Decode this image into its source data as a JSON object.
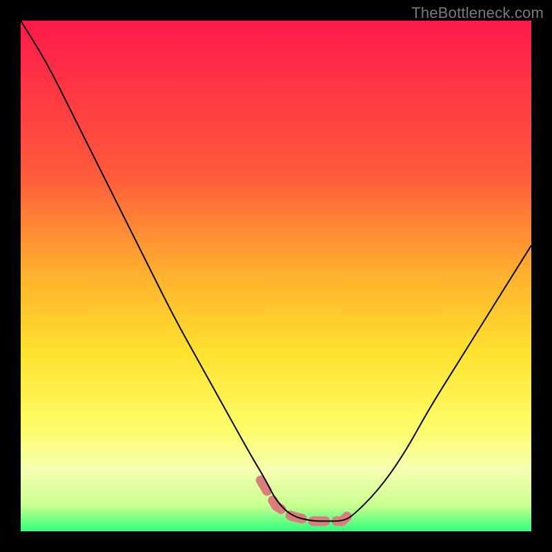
{
  "watermark": "TheBottleneck.com",
  "chart_data": {
    "type": "line",
    "title": "",
    "xlabel": "",
    "ylabel": "",
    "xlim": [
      0,
      100
    ],
    "ylim": [
      0,
      100
    ],
    "gradient": {
      "stops": [
        {
          "offset": 0,
          "color": "#ff1a4a"
        },
        {
          "offset": 30,
          "color": "#ff5a3c"
        },
        {
          "offset": 50,
          "color": "#ffb22e"
        },
        {
          "offset": 65,
          "color": "#ffe22e"
        },
        {
          "offset": 80,
          "color": "#fdfd6a"
        },
        {
          "offset": 88,
          "color": "#f6ffb0"
        },
        {
          "offset": 95,
          "color": "#c8ff90"
        },
        {
          "offset": 100,
          "color": "#2cff7a"
        }
      ]
    },
    "series": [
      {
        "name": "bottleneck-curve",
        "x": [
          0,
          5,
          10,
          15,
          20,
          25,
          30,
          35,
          40,
          45,
          48,
          50,
          53,
          57,
          60,
          63,
          65,
          70,
          75,
          80,
          85,
          90,
          95,
          100
        ],
        "y": [
          100,
          92,
          82,
          72,
          62,
          52,
          42,
          33,
          24,
          15,
          10,
          6,
          3,
          2,
          2,
          2,
          3,
          8,
          15,
          24,
          32,
          40,
          48,
          56
        ]
      },
      {
        "name": "optimal-zone-highlight",
        "x": [
          47,
          50,
          53,
          57,
          60,
          63,
          65
        ],
        "y": [
          10,
          5,
          3,
          2,
          2,
          2,
          4
        ]
      }
    ]
  }
}
